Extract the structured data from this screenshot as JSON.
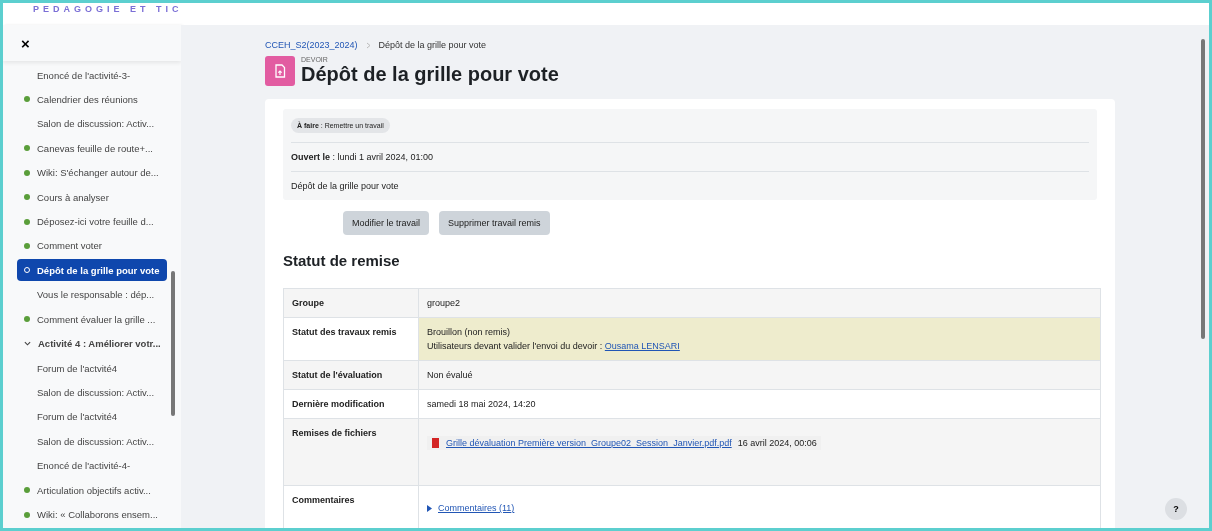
{
  "header": {
    "logo": "PEDAGOGIE ET TIC"
  },
  "sidebar": {
    "close": "×",
    "items": [
      {
        "kind": "activity",
        "label": "Enoncé de l'activité-3-",
        "selected": false
      },
      {
        "kind": "activity",
        "label": "Calendrier des réunions",
        "completed": true,
        "selected": false
      },
      {
        "kind": "activity",
        "label": "Salon de discussion: Activ...",
        "selected": false
      },
      {
        "kind": "activity",
        "label": "Canevas feuille de route+...",
        "completed": true,
        "selected": false
      },
      {
        "kind": "activity",
        "label": "Wiki: S'échanger autour de...",
        "completed": true,
        "selected": false
      },
      {
        "kind": "activity",
        "label": "Cours à analyser",
        "completed": true,
        "selected": false
      },
      {
        "kind": "activity",
        "label": "Déposez-ici votre feuille d...",
        "completed": true,
        "selected": false
      },
      {
        "kind": "activity",
        "label": "Comment voter",
        "completed": true,
        "selected": false
      },
      {
        "kind": "activity",
        "label": "Dépôt de la grille pour vote",
        "completed": false,
        "selected": true
      },
      {
        "kind": "activity",
        "label": "Vous le responsable : dép...",
        "selected": false
      },
      {
        "kind": "activity",
        "label": "Comment évaluer la grille ...",
        "completed": true,
        "selected": false
      },
      {
        "kind": "section",
        "label": "Activité 4 : Améliorer votr...",
        "expanded": true
      },
      {
        "kind": "activity",
        "label": "Forum de l'actvité4",
        "selected": false
      },
      {
        "kind": "activity",
        "label": "Salon de discussion: Activ...",
        "selected": false
      },
      {
        "kind": "activity",
        "label": "Forum de l'actvité4",
        "selected": false
      },
      {
        "kind": "activity",
        "label": "Salon de discussion: Activ...",
        "selected": false
      },
      {
        "kind": "activity",
        "label": "Enoncé de l'activité-4-",
        "selected": false
      },
      {
        "kind": "activity",
        "label": "Articulation objectifs activ...",
        "completed": true,
        "selected": false
      },
      {
        "kind": "activity",
        "label": "Wiki: « Collaborons ensem...",
        "completed": true,
        "selected": false
      }
    ]
  },
  "breadcrumb": [
    {
      "label": "CCEH_S2(2023_2024)",
      "link": true
    },
    {
      "label": "Dépôt de la grille pour vote",
      "link": false
    }
  ],
  "activity": {
    "type": "DEVOIR",
    "title": "Dépôt de la grille pour vote"
  },
  "info": {
    "todo_badge": "**À faire** : Remettre un travail",
    "opened": "**Ouvert le** : lundi 1 avril 2024, 01:00",
    "description": "Dépôt de la grille pour vote"
  },
  "buttons": [
    "Modifier le travail",
    "Supprimer travail remis"
  ],
  "status_heading": "Statut de remise",
  "status_table": [
    {
      "kind": "text",
      "label": "Groupe",
      "value": "groupe2",
      "highlight": false
    },
    {
      "kind": "submission",
      "label": "Statut des travaux remis",
      "value": "Brouillon (non remis)",
      "note": "Utilisateurs devant valider l'envoi du devoir : ",
      "link": "Ousama LENSARI",
      "highlight": true
    },
    {
      "kind": "text",
      "label": "Statut de l'évaluation",
      "value": "Non évalué",
      "highlight": false
    },
    {
      "kind": "text",
      "label": "Dernière modification",
      "value": "samedi 18 mai 2024, 14:20",
      "highlight": false
    },
    {
      "kind": "file",
      "label": "Remises de fichiers",
      "link": "Grille dévaluation Première version_Groupe02_Session_Janvier.pdf.pdf",
      "value": "16 avril 2024, 00:06",
      "highlight": false
    },
    {
      "kind": "comments",
      "label": "Commentaires",
      "link": "Commentaires (11)",
      "highlight": false
    }
  ],
  "help": "?"
}
